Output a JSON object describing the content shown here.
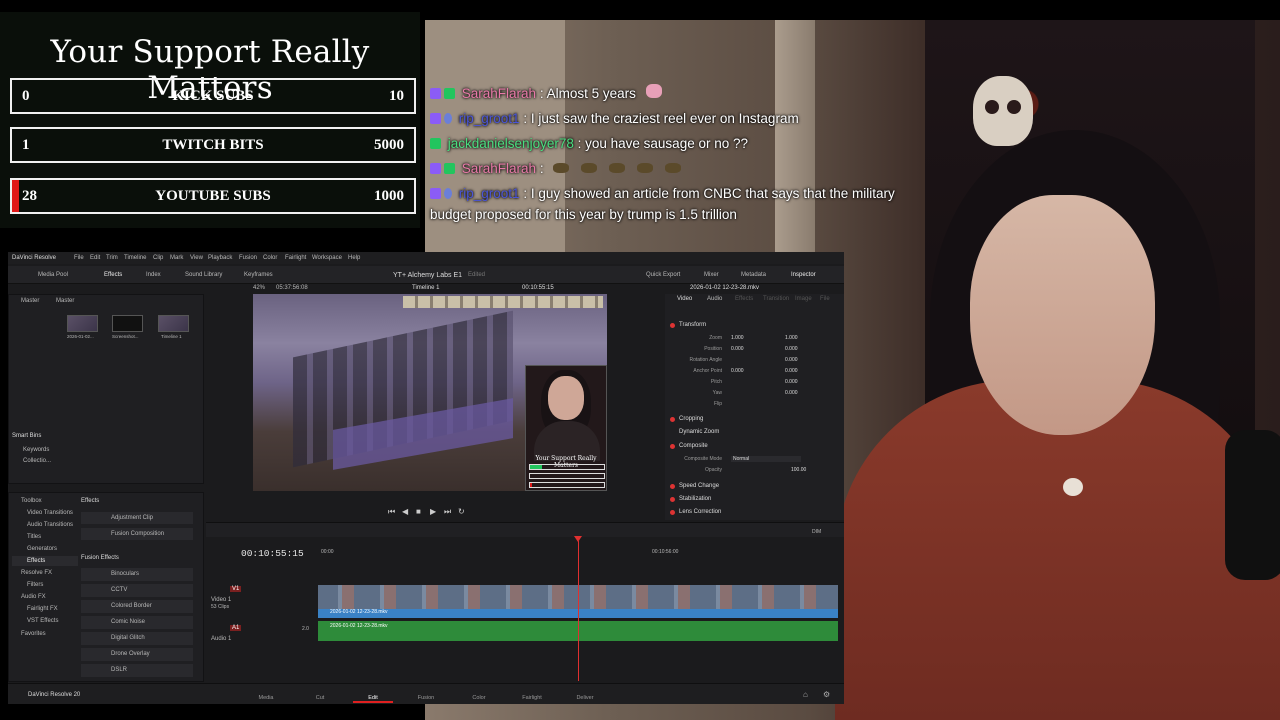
{
  "goals": {
    "title": "Your Support Really Matters",
    "items": [
      {
        "current": "0",
        "label": "KICK SUBS",
        "target": "10",
        "progress": 0
      },
      {
        "current": "1",
        "label": "TWITCH BITS",
        "target": "5000",
        "progress": 0.0002
      },
      {
        "current": "28",
        "label": "YOUTUBE SUBS",
        "target": "1000",
        "progress": 0.028
      }
    ]
  },
  "chat": {
    "messages": [
      {
        "user": "SarahFlarah",
        "color": "#e879a8",
        "text": "Almost 5 years"
      },
      {
        "user": "rip_groot1",
        "color": "#4a55d8",
        "text": "I just saw the craziest reel ever on Instagram"
      },
      {
        "user": "jackdanielsenjoyer78",
        "color": "#4ade80",
        "text": "you have sausage or no ??"
      },
      {
        "user": "SarahFlarah",
        "color": "#e879a8",
        "text": ""
      },
      {
        "user": "rip_groot1",
        "color": "#4a55d8",
        "text": "I guy showed an article from CNBC that says that the military budget proposed for this year by trump is 1.5 trillion"
      }
    ]
  },
  "resolve": {
    "app_name": "DaVinci Resolve",
    "menus": [
      "File",
      "Edit",
      "Trim",
      "Timeline",
      "Clip",
      "Mark",
      "View",
      "Playback",
      "Fusion",
      "Color",
      "Fairlight",
      "Workspace",
      "Help"
    ],
    "toolbar_left": [
      "Media Pool",
      "Effects",
      "Index",
      "Sound Library",
      "Keyframes"
    ],
    "project_title": "YT+ Alchemy Labs E1",
    "project_status": "Edited",
    "toolbar_right": [
      "Quick Export",
      "Mixer",
      "Metadata",
      "Inspector"
    ],
    "viewer_zoom": "42%",
    "viewer_source_tc": "05:37:56:08",
    "timeline_name": "Timeline 1",
    "viewer_tc": "00:10:55:15",
    "clip_name": "2026-01-02 12-23-28.mkv",
    "media_pool": {
      "bins": [
        "Master",
        "Master"
      ],
      "thumbs": [
        "2026-01-02...",
        "Screenshot...",
        "Timeline 1"
      ],
      "smart_bins": "Smart Bins",
      "smart_items": [
        "Keywords",
        "Collectio..."
      ]
    },
    "effects_tree": [
      "Toolbox",
      "Video Transitions",
      "Audio Transitions",
      "Titles",
      "Generators",
      "Effects",
      "Resolve FX",
      "Filters",
      "Audio FX",
      "Fairlight FX",
      "VST Effects",
      "Favorites"
    ],
    "effects_header": "Effects",
    "effects_list": [
      "Adjustment Clip",
      "Fusion Composition"
    ],
    "fusion_header": "Fusion Effects",
    "fusion_list": [
      "Binoculars",
      "CCTV",
      "Colored Border",
      "Comic Noise",
      "Digital Glitch",
      "Drone Overlay",
      "DSLR"
    ],
    "inspector": {
      "tabs": [
        "Video",
        "Audio",
        "Effects",
        "Transition",
        "Image",
        "File"
      ],
      "transform": "Transform",
      "rows": [
        {
          "label": "Zoom",
          "x": "1.000",
          "y": "1.000"
        },
        {
          "label": "Position",
          "x": "0.000",
          "y": "0.000"
        },
        {
          "label": "Rotation Angle",
          "x": "",
          "y": "0.000"
        },
        {
          "label": "Anchor Point",
          "x": "0.000",
          "y": "0.000"
        },
        {
          "label": "Pitch",
          "x": "",
          "y": "0.000"
        },
        {
          "label": "Yaw",
          "x": "",
          "y": "0.000"
        },
        {
          "label": "Flip",
          "x": "",
          "y": ""
        }
      ],
      "sections": [
        "Cropping",
        "Dynamic Zoom",
        "Composite"
      ],
      "composite_mode_label": "Composite Mode",
      "composite_mode": "Normal",
      "opacity_label": "Opacity",
      "opacity": "100.00",
      "more_sections": [
        "Speed Change",
        "Stabilization",
        "Lens Correction"
      ]
    },
    "timeline": {
      "timecode": "00:10:55:15",
      "ruler_start": "00:00",
      "ruler_mid": "00:10:56:00",
      "v1_label": "V1",
      "v1_name": "Video 1",
      "v1_clips": "53 Clips",
      "a1_label": "A1",
      "a1_name": "Audio 1",
      "a1_level": "2.0",
      "video_clip": "2026-01-02 12-23-28.mkv",
      "audio_clip": "2026-01-02 12-23-28.mkv",
      "dim": "DIM"
    },
    "pages": [
      "Media",
      "Cut",
      "Edit",
      "Fusion",
      "Color",
      "Fairlight",
      "Deliver"
    ],
    "active_page": "Edit",
    "footer_brand": "DaVinci Resolve 20"
  },
  "pip": {
    "title": "Your Support Really Matters"
  }
}
